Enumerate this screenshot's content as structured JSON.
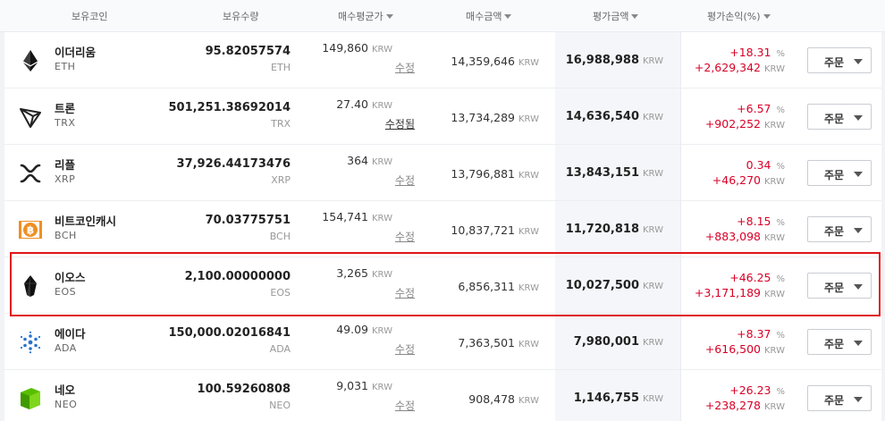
{
  "header": {
    "coin": "보유코인",
    "qty": "보유수량",
    "avg": "매수평균가",
    "buy": "매수금액",
    "eval": "평가금액",
    "pnl": "평가손익(%)"
  },
  "order_label": "주문",
  "rows": [
    {
      "name": "이더리움",
      "sym": "ETH",
      "icon": "ethereum-icon",
      "qty": "95.82057574",
      "avg": "149,860",
      "edit": "수정",
      "buy": "14,359,646",
      "eval": "16,988,988",
      "pct": "+18.31",
      "amt": "+2,629,342",
      "unit": "KRW",
      "pct_unit": "%"
    },
    {
      "name": "트론",
      "sym": "TRX",
      "icon": "tron-icon",
      "qty": "501,251.38692014",
      "avg": "27.40",
      "edit": "수정됨",
      "buy": "13,734,289",
      "eval": "14,636,540",
      "pct": "+6.57",
      "amt": "+902,252",
      "unit": "KRW",
      "pct_unit": "%"
    },
    {
      "name": "리플",
      "sym": "XRP",
      "icon": "ripple-icon",
      "qty": "37,926.44173476",
      "avg": "364",
      "edit": "수정",
      "buy": "13,796,881",
      "eval": "13,843,151",
      "pct": "0.34",
      "amt": "+46,270",
      "unit": "KRW",
      "pct_unit": "%"
    },
    {
      "name": "비트코인캐시",
      "sym": "BCH",
      "icon": "bitcoin-cash-icon",
      "qty": "70.03775751",
      "avg": "154,741",
      "edit": "수정",
      "buy": "10,837,721",
      "eval": "11,720,818",
      "pct": "+8.15",
      "amt": "+883,098",
      "unit": "KRW",
      "pct_unit": "%"
    },
    {
      "name": "이오스",
      "sym": "EOS",
      "icon": "eos-icon",
      "qty": "2,100.00000000",
      "avg": "3,265",
      "edit": "수정",
      "buy": "6,856,311",
      "eval": "10,027,500",
      "pct": "+46.25",
      "amt": "+3,171,189",
      "unit": "KRW",
      "pct_unit": "%"
    },
    {
      "name": "에이다",
      "sym": "ADA",
      "icon": "cardano-icon",
      "qty": "150,000.02016841",
      "avg": "49.09",
      "edit": "수정",
      "buy": "7,363,501",
      "eval": "7,980,001",
      "pct": "+8.37",
      "amt": "+616,500",
      "unit": "KRW",
      "pct_unit": "%"
    },
    {
      "name": "네오",
      "sym": "NEO",
      "icon": "neo-icon",
      "qty": "100.59260808",
      "avg": "9,031",
      "edit": "수정",
      "buy": "908,478",
      "eval": "1,146,755",
      "pct": "+26.23",
      "amt": "+238,278",
      "unit": "KRW",
      "pct_unit": "%"
    }
  ],
  "colors": {
    "positive": "#d80027",
    "highlight": "#e0161b"
  }
}
